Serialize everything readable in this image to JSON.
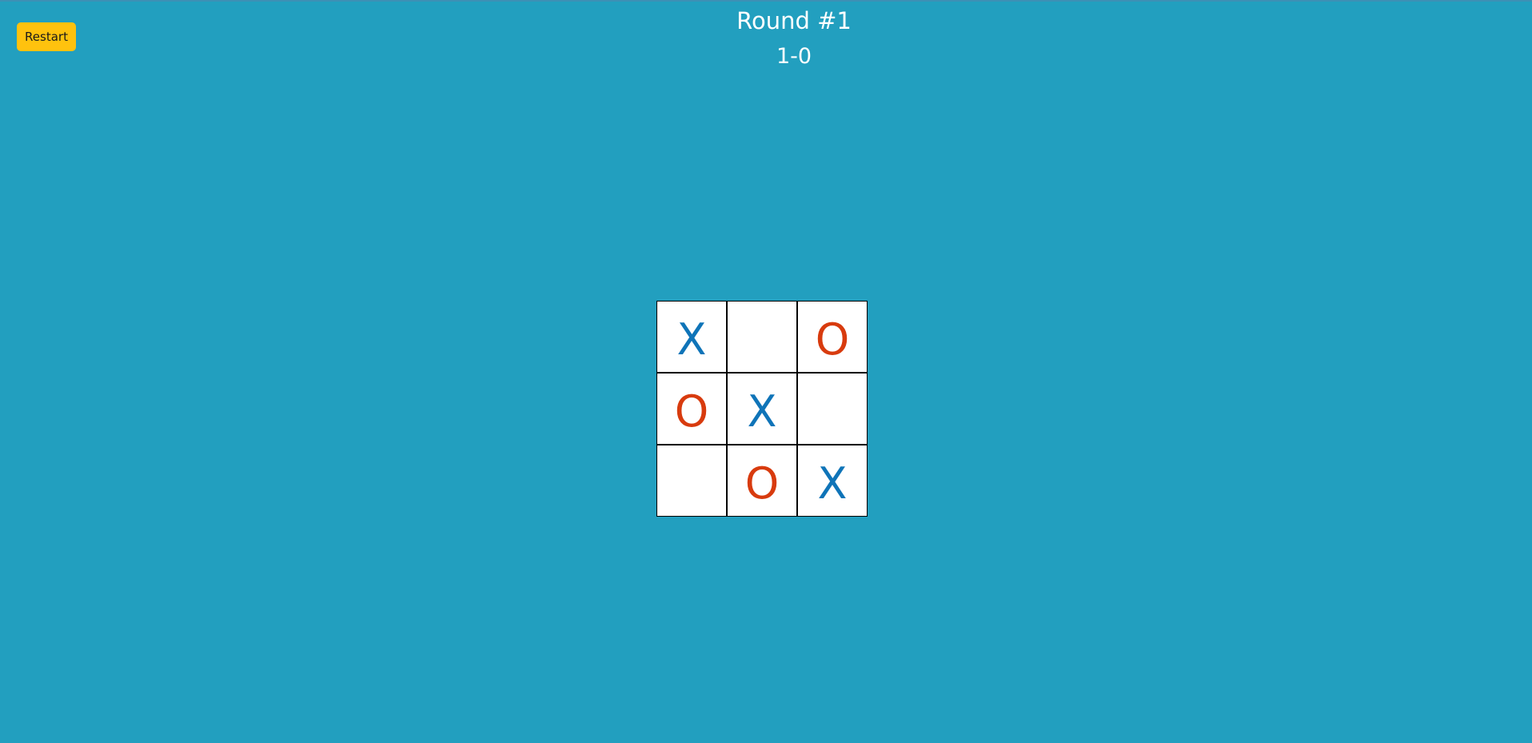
{
  "header": {
    "restart_label": "Restart",
    "round_title": "Round #1",
    "score": "1-0"
  },
  "board": {
    "cells": [
      "X",
      "",
      "O",
      "O",
      "X",
      "",
      "",
      "O",
      "X"
    ]
  },
  "colors": {
    "background": "#229FBF",
    "restart_button": "#FFC20E",
    "x_mark": "#0F74B8",
    "o_mark": "#D83B0E"
  }
}
